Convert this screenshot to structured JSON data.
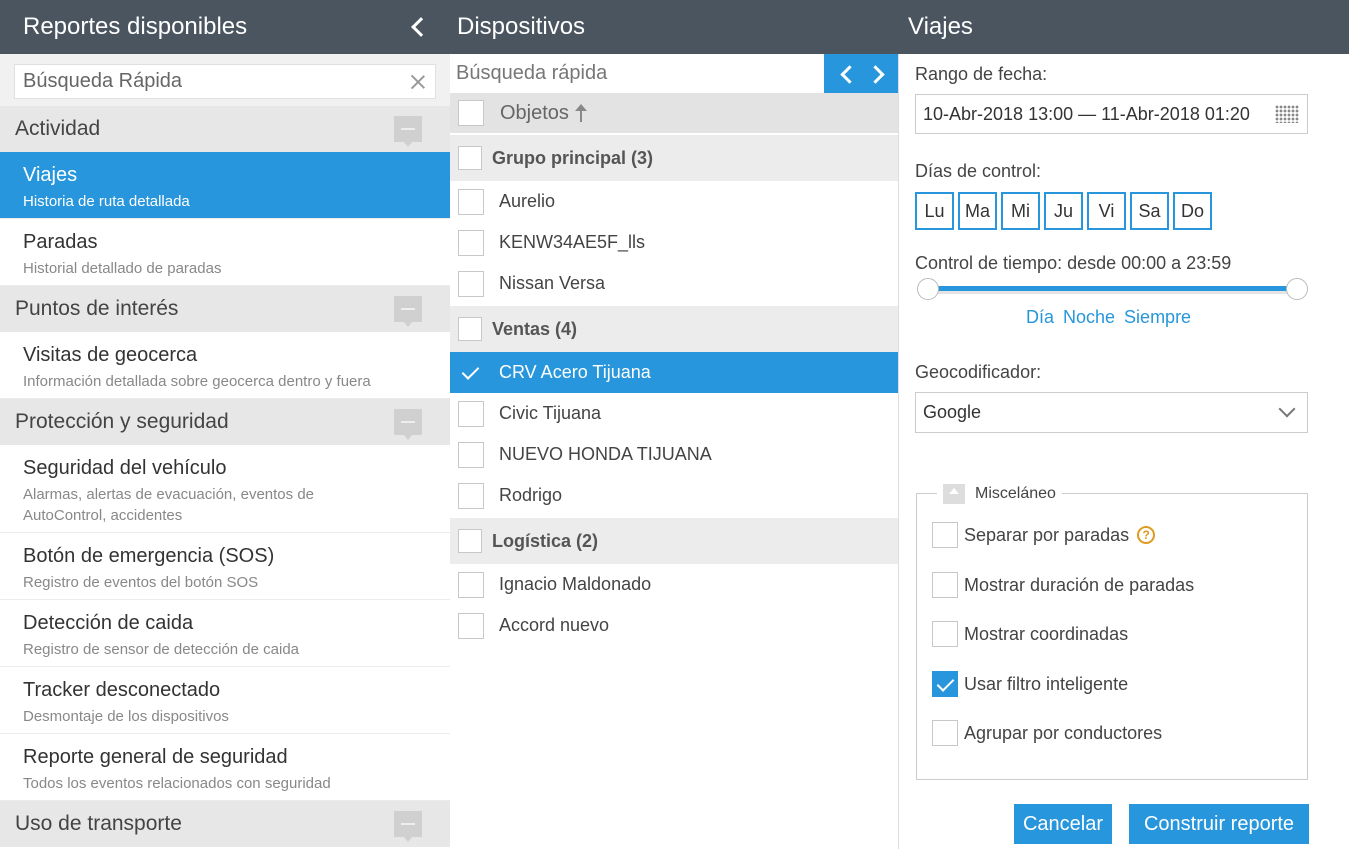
{
  "left": {
    "title": "Reportes disponibles",
    "search_placeholder": "Búsqueda Rápida",
    "categories": [
      {
        "name": "Actividad",
        "items": [
          {
            "title": "Viajes",
            "subtitle": "Historia de ruta detallada",
            "selected": true
          },
          {
            "title": "Paradas",
            "subtitle": "Historial detallado de paradas",
            "selected": false
          }
        ]
      },
      {
        "name": "Puntos de interés",
        "items": [
          {
            "title": "Visitas de geocerca",
            "subtitle": "Información detallada sobre geocerca dentro y fuera",
            "selected": false
          }
        ]
      },
      {
        "name": "Protección y seguridad",
        "items": [
          {
            "title": "Seguridad del vehículo",
            "subtitle": "Alarmas, alertas de evacuación, eventos de AutoControl, accidentes",
            "selected": false
          },
          {
            "title": "Botón de emergencia (SOS)",
            "subtitle": "Registro de eventos del botón SOS",
            "selected": false
          },
          {
            "title": "Detección de caida",
            "subtitle": "Registro de sensor de detección de caida",
            "selected": false
          },
          {
            "title": "Tracker desconectado",
            "subtitle": "Desmontaje de los dispositivos",
            "selected": false
          },
          {
            "title": "Reporte general de seguridad",
            "subtitle": "Todos los eventos relacionados con seguridad",
            "selected": false
          }
        ]
      },
      {
        "name": "Uso de transporte",
        "items": []
      }
    ]
  },
  "mid": {
    "title": "Dispositivos",
    "search_placeholder": "Búsqueda rápida",
    "objects_header": "Objetos",
    "groups": [
      {
        "name": "Grupo principal (3)",
        "devices": [
          {
            "name": "Aurelio",
            "selected": false
          },
          {
            "name": "KENW34AE5F_lls",
            "selected": false
          },
          {
            "name": "Nissan Versa",
            "selected": false
          }
        ]
      },
      {
        "name": "Ventas (4)",
        "devices": [
          {
            "name": "CRV Acero Tijuana",
            "selected": true
          },
          {
            "name": "Civic Tijuana",
            "selected": false
          },
          {
            "name": "NUEVO HONDA TIJUANA",
            "selected": false
          },
          {
            "name": "Rodrigo",
            "selected": false
          }
        ]
      },
      {
        "name": "Logística (2)",
        "devices": [
          {
            "name": "Ignacio Maldonado",
            "selected": false
          },
          {
            "name": "Accord nuevo",
            "selected": false
          }
        ]
      }
    ]
  },
  "right": {
    "title": "Viajes",
    "date_range_label": "Rango de fecha:",
    "date_range_value": "10-Abr-2018 13:00 — 11-Abr-2018 01:20",
    "control_days_label": "Días de control:",
    "days": [
      "Lu",
      "Ma",
      "Mi",
      "Ju",
      "Vi",
      "Sa",
      "Do"
    ],
    "time_control_label": "Control de tiempo: desde 00:00 a 23:59",
    "time_links": [
      "Día",
      "Noche",
      "Siempre"
    ],
    "geocoder_label": "Geocodificador:",
    "geocoder_value": "Google",
    "misc_label": "Misceláneo",
    "options": [
      {
        "label": "Separar por paradas",
        "checked": false,
        "help": true
      },
      {
        "label": "Mostrar duración de paradas",
        "checked": false,
        "help": false
      },
      {
        "label": "Mostrar coordinadas",
        "checked": false,
        "help": false
      },
      {
        "label": "Usar filtro inteligente",
        "checked": true,
        "help": false
      },
      {
        "label": "Agrupar por conductores",
        "checked": false,
        "help": false
      }
    ],
    "cancel_label": "Cancelar",
    "build_label": "Construir reporte"
  },
  "colors": {
    "accent": "#2796dc",
    "header": "#4a5560"
  }
}
